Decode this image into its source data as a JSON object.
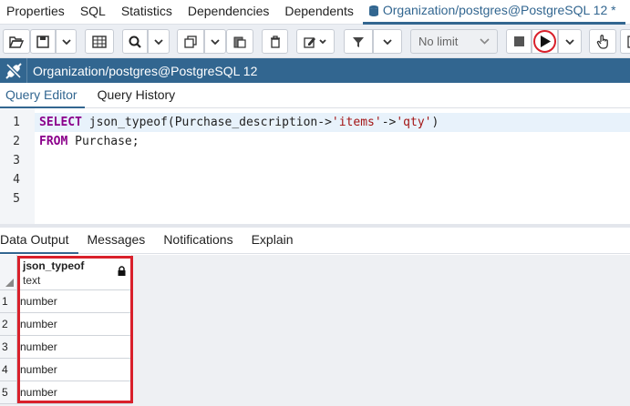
{
  "top_tabs": [
    "Properties",
    "SQL",
    "Statistics",
    "Dependencies",
    "Dependents",
    "Organization/postgres@PostgreSQL 12 *"
  ],
  "toolbar": {
    "limit_label": "No limit"
  },
  "connection": {
    "label": "Organization/postgres@PostgreSQL 12"
  },
  "editor_tabs": [
    "Query Editor",
    "Query History"
  ],
  "editor": {
    "line_numbers": [
      "1",
      "2",
      "3",
      "4",
      "5"
    ],
    "line1": {
      "kw": "SELECT",
      "fn": " json_typeof(Purchase_description->",
      "s1": "'items'",
      "mid": "->",
      "s2": "'qty'",
      "end": ")"
    },
    "line2": {
      "kw": "FROM",
      "rest": " Purchase;"
    }
  },
  "output_tabs": [
    "Data Output",
    "Messages",
    "Notifications",
    "Explain"
  ],
  "grid": {
    "column": {
      "name": "json_typeof",
      "type": "text"
    },
    "rows": [
      {
        "n": "1",
        "v": "number"
      },
      {
        "n": "2",
        "v": "number"
      },
      {
        "n": "3",
        "v": "number"
      },
      {
        "n": "4",
        "v": "number"
      },
      {
        "n": "5",
        "v": "number"
      }
    ]
  },
  "colors": {
    "accent": "#326690",
    "highlight": "#d9202b"
  }
}
